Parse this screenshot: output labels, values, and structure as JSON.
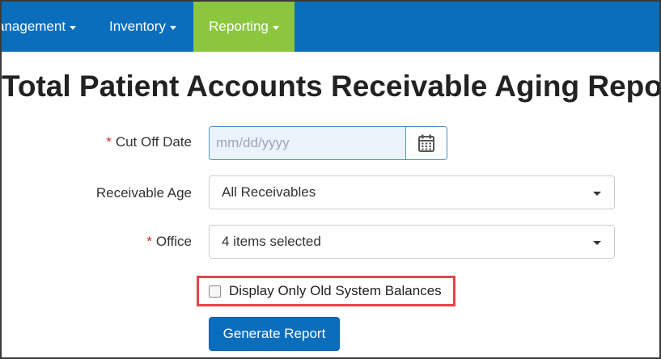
{
  "navbar": {
    "items": [
      {
        "label": "anagement"
      },
      {
        "label": "Inventory"
      },
      {
        "label": "Reporting",
        "active": true
      }
    ],
    "colors": {
      "bar": "#0a6ebd",
      "active": "#8cc63f"
    }
  },
  "page": {
    "title": "Total Patient Accounts Receivable Aging Report"
  },
  "form": {
    "required_mark": "*",
    "cut_off_date": {
      "label": "Cut Off Date",
      "placeholder": "mm/dd/yyyy",
      "value": ""
    },
    "receivable_age": {
      "label": "Receivable Age",
      "selected": "All Receivables"
    },
    "office": {
      "label": "Office",
      "selected": "4 items selected"
    },
    "old_balances": {
      "label": "Display Only Old System Balances",
      "checked": false
    },
    "generate_label": "Generate Report"
  }
}
